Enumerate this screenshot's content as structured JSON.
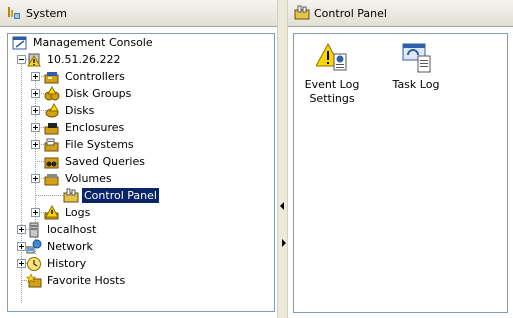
{
  "left_pane": {
    "header": {
      "title": "System",
      "icon": "system-icon"
    },
    "tree": [
      {
        "label": "Management Console",
        "icon": "management-console-icon"
      },
      {
        "label": "10.51.26.222",
        "icon": "server-warning-icon"
      },
      {
        "label": "Controllers",
        "icon": "controllers-icon"
      },
      {
        "label": "Disk Groups",
        "icon": "disk-groups-icon"
      },
      {
        "label": "Disks",
        "icon": "disks-icon"
      },
      {
        "label": "Enclosures",
        "icon": "enclosures-icon"
      },
      {
        "label": "File Systems",
        "icon": "file-systems-icon"
      },
      {
        "label": "Saved Queries",
        "icon": "saved-queries-icon"
      },
      {
        "label": "Volumes",
        "icon": "volumes-icon"
      },
      {
        "label": "Control Panel",
        "icon": "control-panel-icon",
        "selected": true
      },
      {
        "label": "Logs",
        "icon": "logs-warning-icon"
      },
      {
        "label": "localhost",
        "icon": "localhost-icon"
      },
      {
        "label": "Network",
        "icon": "network-icon"
      },
      {
        "label": "History",
        "icon": "history-icon"
      },
      {
        "label": "Favorite Hosts",
        "icon": "favorite-hosts-icon"
      }
    ]
  },
  "right_pane": {
    "header": {
      "title": "Control Panel",
      "icon": "control-panel-icon"
    },
    "items": [
      {
        "label_line1": "Event Log",
        "label_line2": "Settings",
        "icon": "event-log-settings-icon"
      },
      {
        "label_line1": "Task Log",
        "label_line2": "",
        "icon": "task-log-icon"
      }
    ]
  },
  "colors": {
    "selection": "#0a246a",
    "header_bg": "#ece9d8",
    "border": "#7f9db9"
  }
}
